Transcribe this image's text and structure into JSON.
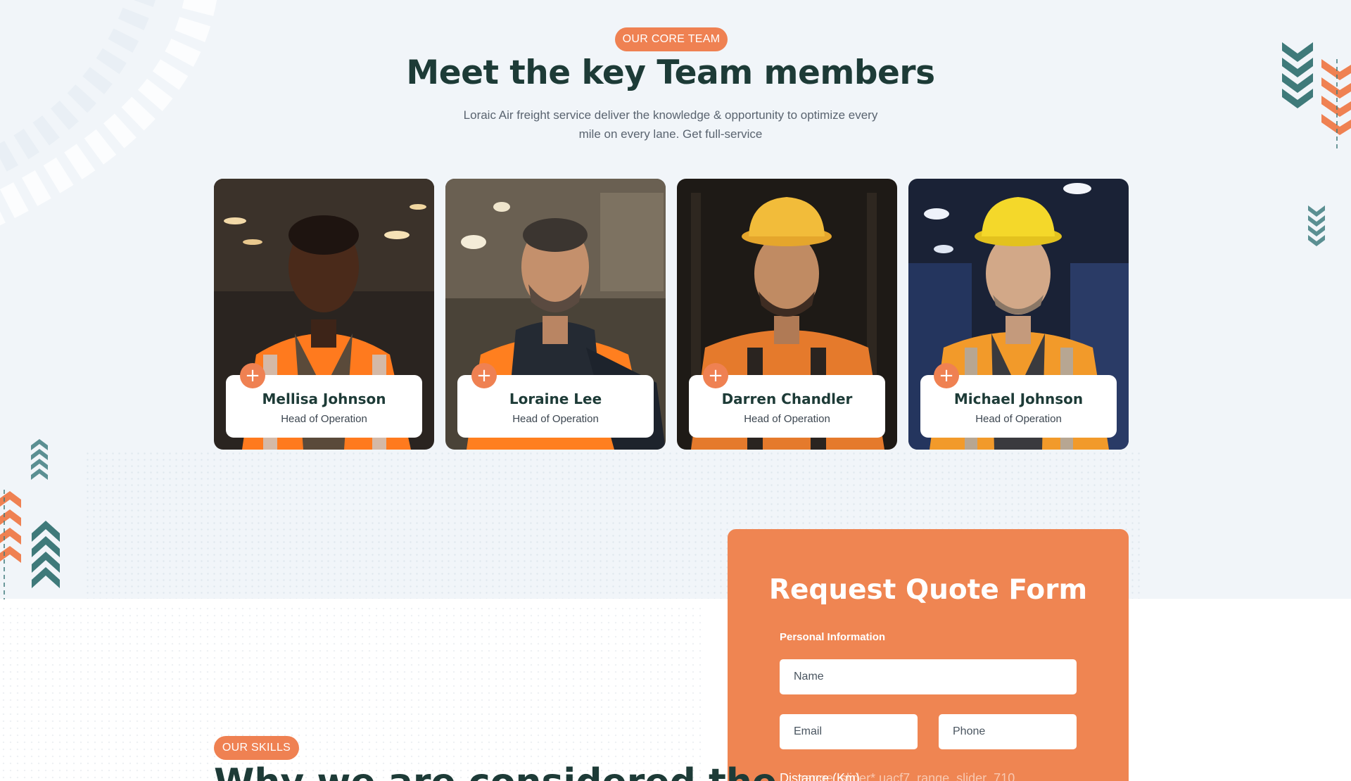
{
  "team": {
    "badge": "OUR CORE TEAM",
    "title": "Meet the key Team members",
    "subtitle": "Loraic Air freight service deliver the knowledge & opportunity to optimize every mile on every lane. Get full-service",
    "plus_icon": "+",
    "members": [
      {
        "name": "Mellisa Johnson",
        "role": "Head of Operation"
      },
      {
        "name": "Loraine Lee",
        "role": "Head of Operation"
      },
      {
        "name": "Darren Chandler",
        "role": "Head of Operation"
      },
      {
        "name": "Michael Johnson",
        "role": "Head of Operation"
      }
    ]
  },
  "quote_form": {
    "title": "Request Quote Form",
    "section_label": "Personal Information",
    "name_placeholder": "Name",
    "email_placeholder": "Email",
    "phone_placeholder": "Phone",
    "distance_label": "Distance (Km)",
    "slider_ghost_text": "range_slider* uacf7_range_slider_710"
  },
  "skills": {
    "badge": "OUR SKILLS",
    "title": "Why we are considered the"
  },
  "colors": {
    "accent": "#ef8152",
    "dark_green": "#1d3b37",
    "teal": "#3f7a7a",
    "section_bg": "#f1f5f9"
  }
}
